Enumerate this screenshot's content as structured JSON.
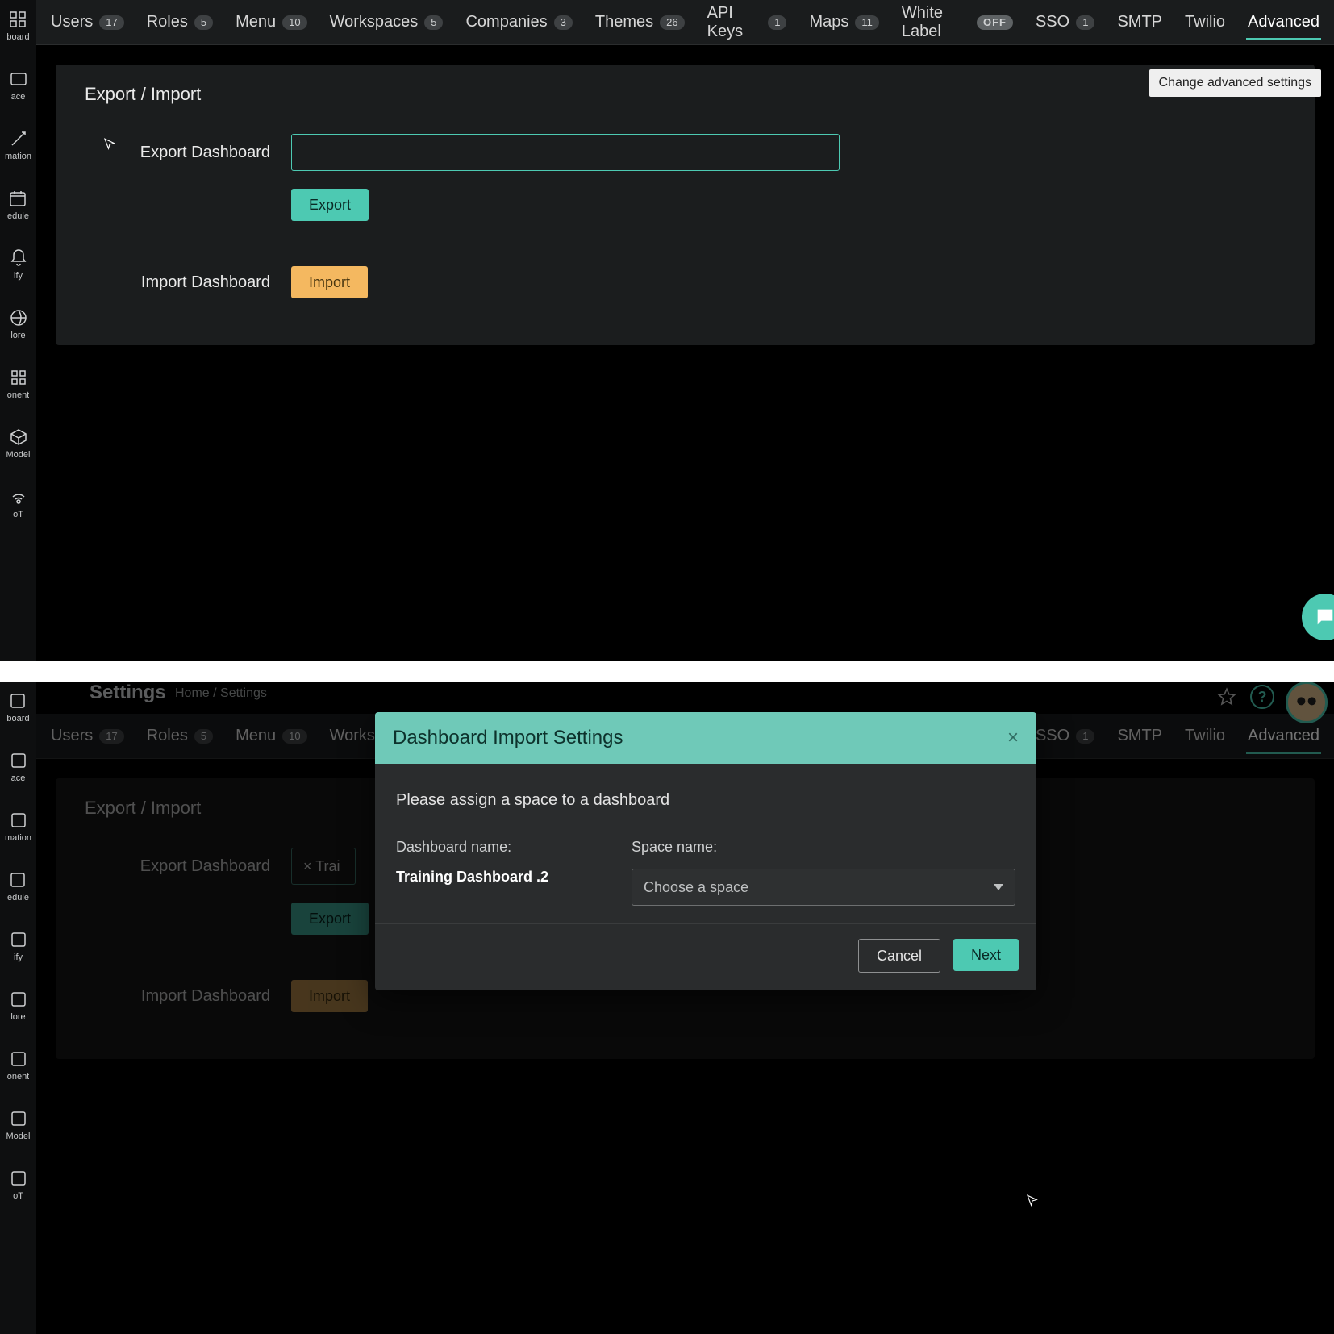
{
  "sidebar": {
    "items": [
      {
        "icon": "dashboard",
        "label": "board"
      },
      {
        "icon": "space",
        "label": "ace"
      },
      {
        "icon": "automation",
        "label": "mation"
      },
      {
        "icon": "schedule",
        "label": "edule"
      },
      {
        "icon": "notify",
        "label": "ify"
      },
      {
        "icon": "explore",
        "label": "lore"
      },
      {
        "icon": "component",
        "label": "onent"
      },
      {
        "icon": "model",
        "label": "Model"
      },
      {
        "icon": "iot",
        "label": "oT"
      }
    ]
  },
  "tabs": [
    {
      "label": "Users",
      "badge": "17"
    },
    {
      "label": "Roles",
      "badge": "5"
    },
    {
      "label": "Menu",
      "badge": "10"
    },
    {
      "label": "Workspaces",
      "badge": "5"
    },
    {
      "label": "Companies",
      "badge": "3"
    },
    {
      "label": "Themes",
      "badge": "26"
    },
    {
      "label": "API Keys",
      "badge": "1"
    },
    {
      "label": "Maps",
      "badge": "11"
    },
    {
      "label": "White Label",
      "badge": "OFF",
      "off": true
    },
    {
      "label": "SSO",
      "badge": "1"
    },
    {
      "label": "SMTP"
    },
    {
      "label": "Twilio"
    },
    {
      "label": "Advanced",
      "active": true
    }
  ],
  "tooltip": "Change advanced settings",
  "panel": {
    "title": "Export / Import",
    "exportLabel": "Export Dashboard",
    "exportBtn": "Export",
    "importLabel": "Import Dashboard",
    "importBtn": "Import"
  },
  "bottom": {
    "pageTitle": "Settings",
    "breadcrumb": {
      "a": "Home",
      "sep": "/",
      "b": "Settings"
    },
    "helpGlyph": "?",
    "exportValue": "× Trai"
  },
  "modal": {
    "title": "Dashboard Import Settings",
    "intro": "Please assign a space to a dashboard",
    "dashNameLabel": "Dashboard name:",
    "dashNameValue": "Training Dashboard .2",
    "spaceLabel": "Space name:",
    "spacePlaceholder": "Choose a space",
    "cancel": "Cancel",
    "next": "Next",
    "closeGlyph": "×"
  }
}
